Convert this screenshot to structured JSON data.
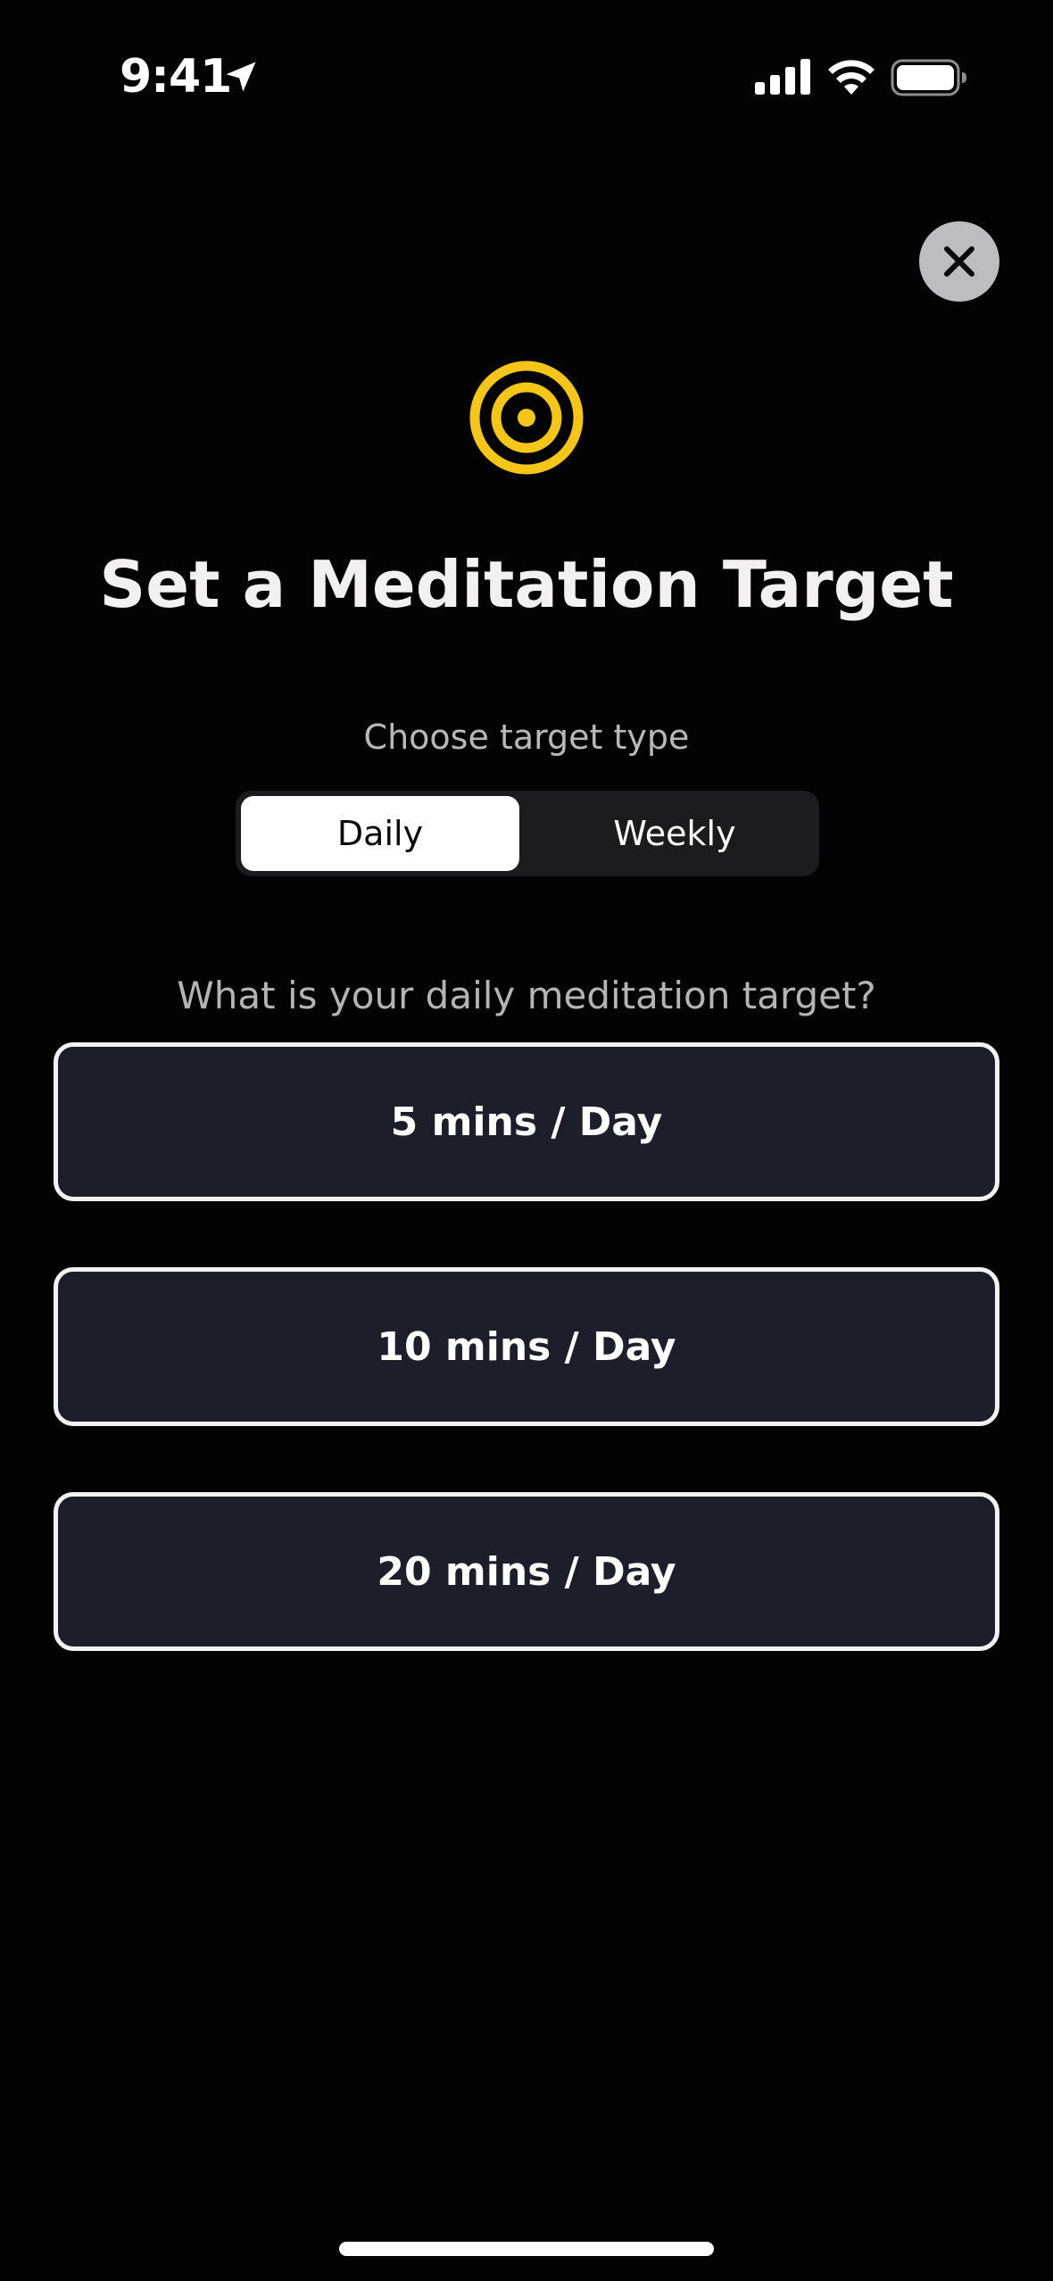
{
  "status_bar": {
    "time": "9:41",
    "icons": [
      "location-arrow-icon",
      "cellular-signal-icon",
      "wifi-icon",
      "battery-icon"
    ]
  },
  "header": {
    "close_icon": "close-icon",
    "target_icon": "target-icon",
    "title": "Set a Meditation Target"
  },
  "target_type": {
    "label": "Choose target type",
    "options": [
      "Daily",
      "Weekly"
    ],
    "selected": "Daily"
  },
  "question": "What is your daily meditation target?",
  "options": [
    {
      "label": "5 mins / Day"
    },
    {
      "label": "10 mins / Day"
    },
    {
      "label": "20 mins / Day"
    }
  ],
  "colors": {
    "background": "#030303",
    "accent": "#f5c518",
    "option_fill": "#1c1e29",
    "option_border": "#f2f2f2",
    "segment_track": "#1c1c1e",
    "segment_selected": "#ffffff",
    "close_button": "#bdbdbf"
  }
}
